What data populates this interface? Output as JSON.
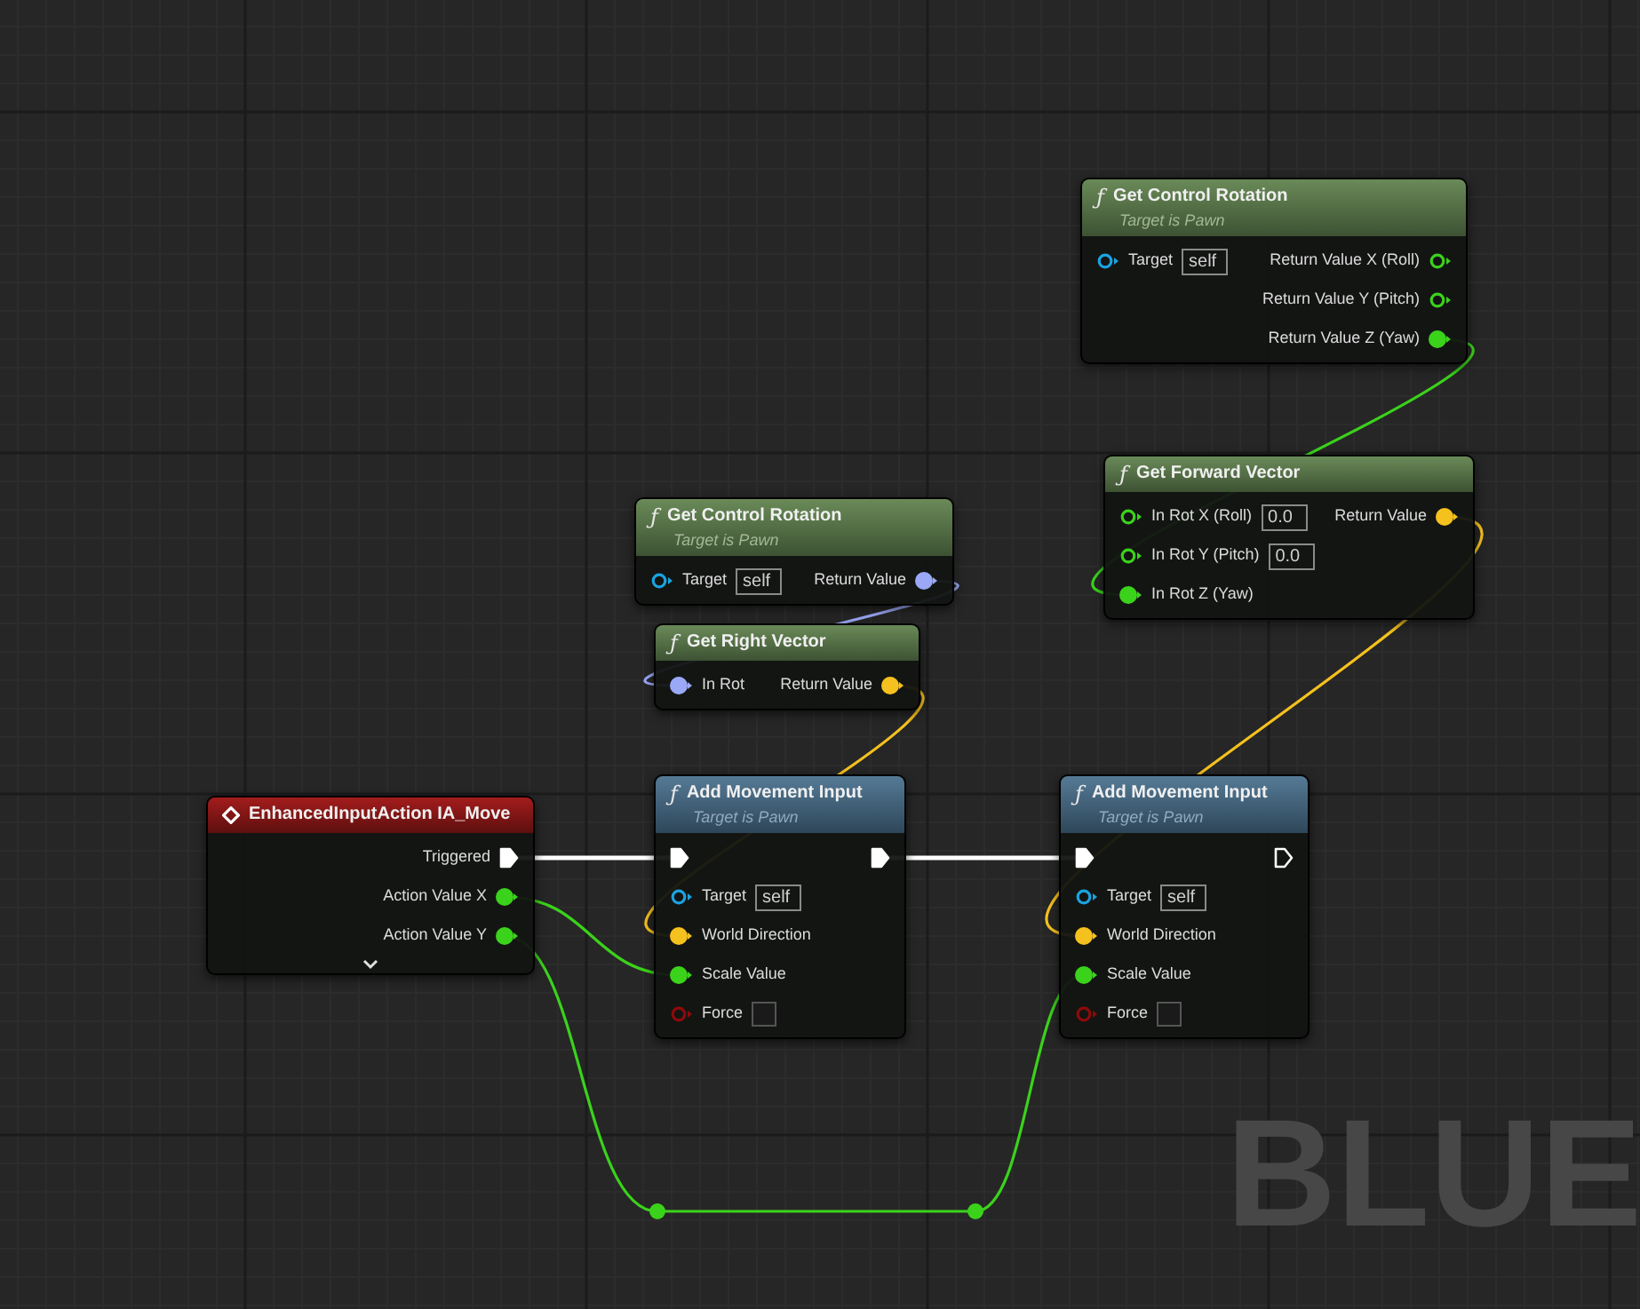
{
  "nodes": [
    {
      "kind": "pure",
      "icon": "ƒ",
      "title": "Get Control Rotation",
      "subtitle": "Target is Pawn",
      "inputs": [
        {
          "kind": "object",
          "label": "Target",
          "connected": false,
          "default": "self"
        }
      ],
      "outputs": [
        {
          "kind": "float",
          "label": "Return Value X (Roll)",
          "connected": false
        },
        {
          "kind": "float",
          "label": "Return Value Y (Pitch)",
          "connected": false
        },
        {
          "kind": "float",
          "label": "Return Value Z (Yaw)",
          "connected": true
        }
      ]
    },
    {
      "kind": "pure",
      "icon": "ƒ",
      "title": "Get Forward Vector",
      "inputs": [
        {
          "kind": "float",
          "label": "In Rot X (Roll)",
          "connected": false,
          "default": "0.0"
        },
        {
          "kind": "float",
          "label": "In Rot Y (Pitch)",
          "connected": false,
          "default": "0.0"
        },
        {
          "kind": "float",
          "label": "In Rot Z (Yaw)",
          "connected": true
        }
      ],
      "outputs": [
        {
          "kind": "vector",
          "label": "Return Value",
          "connected": true
        }
      ]
    },
    {
      "kind": "pure",
      "icon": "ƒ",
      "title": "Get Control Rotation",
      "subtitle": "Target is Pawn",
      "inputs": [
        {
          "kind": "object",
          "label": "Target",
          "connected": false,
          "default": "self"
        }
      ],
      "outputs": [
        {
          "kind": "rotator",
          "label": "Return Value",
          "connected": true
        }
      ]
    },
    {
      "kind": "pure",
      "icon": "ƒ",
      "title": "Get Right Vector",
      "inputs": [
        {
          "kind": "rotator",
          "label": "In Rot",
          "connected": true
        }
      ],
      "outputs": [
        {
          "kind": "vector",
          "label": "Return Value",
          "connected": true
        }
      ]
    },
    {
      "kind": "event",
      "title": "EnhancedInputAction IA_Move",
      "show_more": true,
      "outputs": [
        {
          "kind": "exec",
          "label": "Triggered",
          "connected": true
        },
        {
          "kind": "float",
          "label": "Action Value X",
          "connected": true
        },
        {
          "kind": "float",
          "label": "Action Value Y",
          "connected": true
        }
      ]
    },
    {
      "kind": "impure",
      "icon": "ƒ",
      "title": "Add Movement Input",
      "subtitle": "Target is Pawn",
      "inputs": [
        {
          "kind": "exec",
          "connected": true
        },
        {
          "kind": "object",
          "label": "Target",
          "connected": false,
          "default": "self"
        },
        {
          "kind": "vector",
          "label": "World Direction",
          "connected": true
        },
        {
          "kind": "float",
          "label": "Scale Value",
          "connected": true
        },
        {
          "kind": "bool",
          "label": "Force",
          "connected": false,
          "checked": false
        }
      ],
      "outputs": [
        {
          "kind": "exec",
          "connected": true
        }
      ]
    },
    {
      "kind": "impure",
      "icon": "ƒ",
      "title": "Add Movement Input",
      "subtitle": "Target is Pawn",
      "inputs": [
        {
          "kind": "exec",
          "connected": true
        },
        {
          "kind": "object",
          "label": "Target",
          "connected": false,
          "default": "self"
        },
        {
          "kind": "vector",
          "label": "World Direction",
          "connected": true
        },
        {
          "kind": "float",
          "label": "Scale Value",
          "connected": true
        },
        {
          "kind": "bool",
          "label": "Force",
          "connected": false,
          "checked": false
        }
      ],
      "outputs": [
        {
          "kind": "exec",
          "connected": false
        }
      ]
    }
  ],
  "graph_label": "BLUE"
}
